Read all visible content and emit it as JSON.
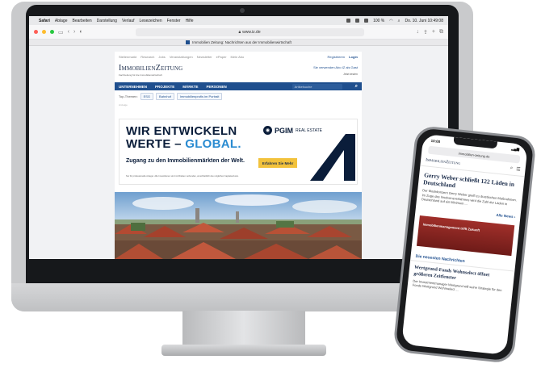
{
  "menubar": {
    "items": [
      "Safari",
      "Ablage",
      "Bearbeiten",
      "Darstellung",
      "Verlauf",
      "Lesezeichen",
      "Fenster",
      "Hilfe"
    ],
    "battery": "100 %",
    "clock": "Do. 10. Juni 10:49:08"
  },
  "browser": {
    "url": "www.iz.de",
    "tab_title": "Immobilien Zeitung: Nachrichten aus der Immobilienwirtschaft"
  },
  "site": {
    "top_links": [
      "Stellenmarkt",
      "Research",
      "Jobs",
      "Veranstaltungen",
      "Newsletter",
      "ePaper",
      "Mein Abo"
    ],
    "register": "Registrieren",
    "login": "Login",
    "logo": "ImmobilienZeitung",
    "logo_sub": "Fachzeitung für die Immobilienwirtschaft",
    "brand_right_1": "Sie verwenden Abo IZ als Gast",
    "brand_right_2": "Jetzt testen",
    "nav": [
      "UNTERNEHMEN",
      "PROJEKTE",
      "MÄRKTE",
      "PERSONEN"
    ],
    "search_placeholder": "Artikelsuche",
    "topics_label": "Top-Themen:",
    "topics": [
      "ESG",
      "Bahnhof",
      "Immobilienprofis im Portrait"
    ],
    "ad_label": "Anzeige",
    "ad": {
      "line1": "WIR ENTWICKELN",
      "line2_a": "WERTE – ",
      "line2_b": "GLOBAL.",
      "subline": "Zugang zu den Immobilienmärkten der Welt.",
      "button": "Erfahren Sie Mehr",
      "fine_print": "Nur für professionelle Anleger. Alle Investitionen sind mit Risiken verbunden, einschließlich des möglichen Kapitalverlusts.",
      "brand": "PGIM",
      "brand_sub": "REAL ESTATE"
    }
  },
  "phone": {
    "time": "10:00",
    "url": "immobilien-zeitung.de",
    "logo": "ImmobilienZeitung",
    "headline": "Gerry Weber schließt 122 Läden in Deutschland",
    "teaser": "Der Modekonzern Gerry Weber greift zu drastischen Maßnahmen. Im Zuge des Insolvenzverfahrens wird die Zahl der Läden in Deutschland auf ein Minimum ...",
    "more": "Alle News",
    "ad_text": "Immobilienmanagement trifft Zukunft",
    "section": "Die neuesten Nachrichten",
    "headline2": "Wertgrund-Fonds Wohnselect öffnet größeren Zeitfenster",
    "teaser2": "Der Investmentmanager Wertgrund will seine Strategie für den Fonds Wertgrund Wohnselect ..."
  },
  "colors": {
    "brand_navy": "#1f4f8e",
    "ad_navy": "#0a1d3a",
    "ad_blue": "#2a8bd1",
    "ad_button": "#f2c23c"
  }
}
